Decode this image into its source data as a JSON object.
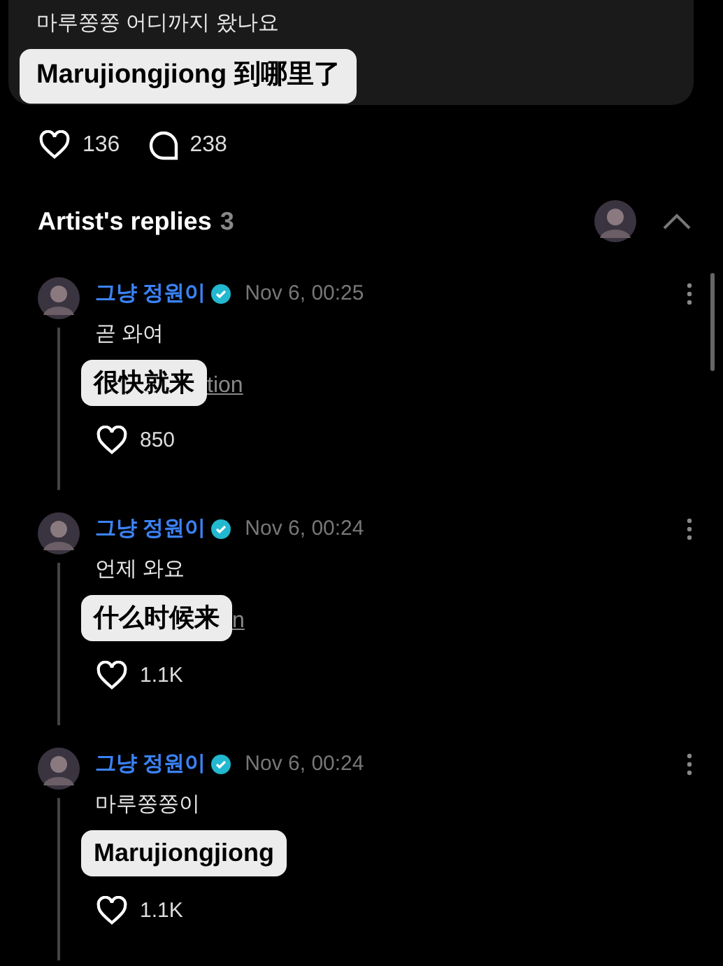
{
  "comment": {
    "text": "마루쫑쫑 어디까지 왔나요",
    "translation": "Marujiongjiong 到哪里了",
    "likes": "136",
    "replies": "238"
  },
  "artist_replies": {
    "title": "Artist's replies",
    "count": "3",
    "expanded": true
  },
  "replies": [
    {
      "author": "그냥 정원이",
      "verified": true,
      "time": "Nov 6, 00:25",
      "text": "곧 와여",
      "translation": "很快就来",
      "link_fragment": "tion",
      "likes": "850"
    },
    {
      "author": "그냥 정원이",
      "verified": true,
      "time": "Nov 6, 00:24",
      "text": "언제 와요",
      "translation": "什么时候来",
      "link_fragment": "n",
      "likes": "1.1K"
    },
    {
      "author": "그냥 정원이",
      "verified": true,
      "time": "Nov 6, 00:24",
      "text": "마루쫑쫑이",
      "translation": "Marujiongjiong",
      "likes": "1.1K"
    }
  ]
}
